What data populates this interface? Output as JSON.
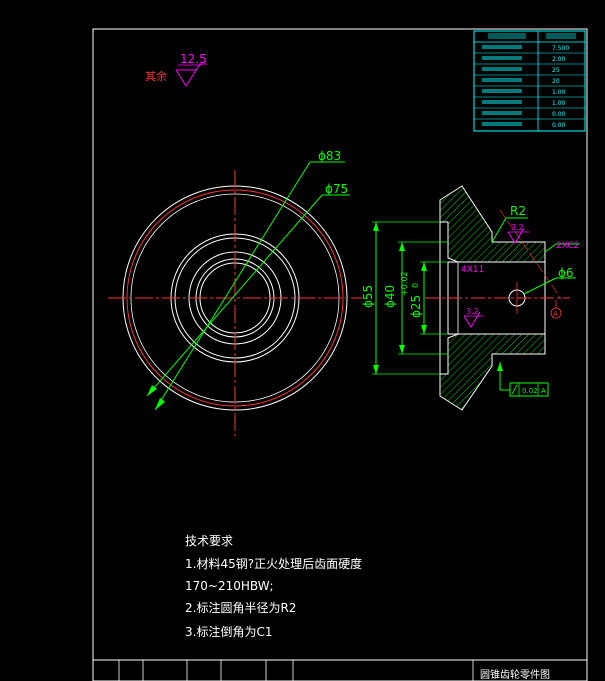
{
  "surface_mark": {
    "label": "其余",
    "value": "12.5"
  },
  "params_table": {
    "rows": [
      {
        "name": "",
        "value": "7.500"
      },
      {
        "name": "",
        "value": "2.00"
      },
      {
        "name": "",
        "value": "25"
      },
      {
        "name": "",
        "value": "20"
      },
      {
        "name": "",
        "value": "1.00"
      },
      {
        "name": "",
        "value": "1.00"
      },
      {
        "name": "",
        "value": "0.00"
      },
      {
        "name": "",
        "value": "0.00"
      }
    ]
  },
  "front_view": {
    "dim_outer": "ϕ83",
    "dim_pitch": "ϕ75"
  },
  "section_view": {
    "dim_r2": "R2",
    "dim_rough_top": "3.2",
    "dim_chamfer": "2XC2",
    "dim_hole": "ϕ6",
    "dim_key": "4X11",
    "dim_d55": "ϕ55",
    "dim_d40": "ϕ40",
    "dim_d25": "ϕ25",
    "dim_tol_upper": "+0.02",
    "dim_tol_lower": "0",
    "dim_rough_bottom": "3.2",
    "dim_gt": "0.02",
    "dim_datum": "A",
    "datum_marker": "A"
  },
  "tech_req": {
    "title": "技术要求",
    "lines": [
      "1.材料45钢?正火处理后齿面硬度",
      "170~210HBW;",
      "2.标注圆角半径为R2",
      "3.标注倒角为C1"
    ]
  },
  "title_block": {
    "name": "圆锥齿轮零件图"
  },
  "colors": {
    "frame": "#ffffff",
    "cyan": "#00ffff",
    "green": "#00ff00",
    "red": "#ff3333",
    "magenta": "#ff00ff",
    "yellow": "#ffff00"
  }
}
